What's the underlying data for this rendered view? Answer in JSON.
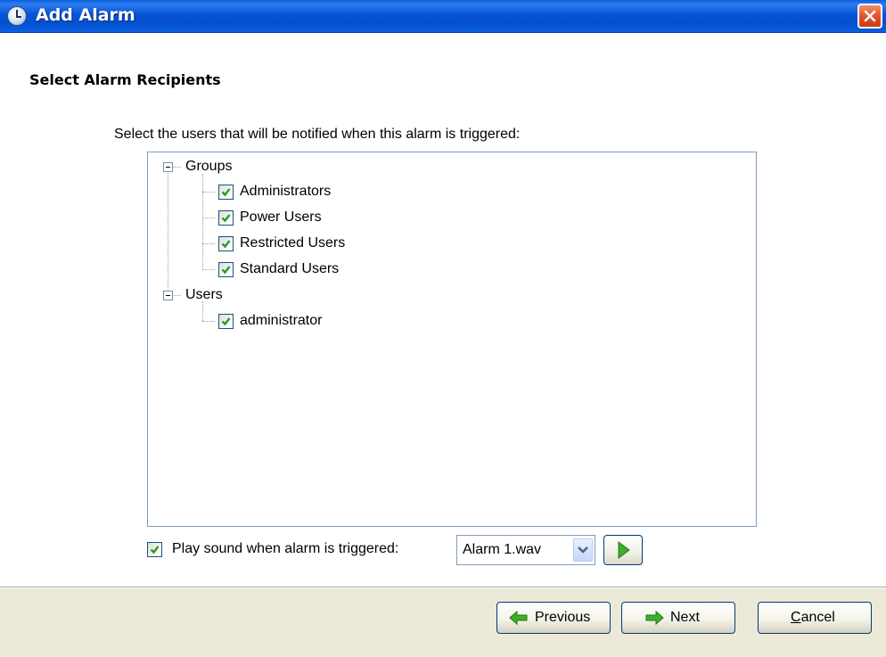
{
  "window": {
    "title": "Add Alarm"
  },
  "page": {
    "heading": "Select Alarm Recipients",
    "instruction": "Select the users that will be notified when this alarm is triggered:"
  },
  "tree": {
    "groups": {
      "label": "Groups",
      "expanded": true,
      "items": [
        {
          "label": "Administrators",
          "checked": true
        },
        {
          "label": "Power Users",
          "checked": true
        },
        {
          "label": "Restricted Users",
          "checked": true
        },
        {
          "label": "Standard Users",
          "checked": true
        }
      ]
    },
    "users": {
      "label": "Users",
      "expanded": true,
      "items": [
        {
          "label": "administrator",
          "checked": true
        }
      ]
    }
  },
  "sound": {
    "checked": true,
    "label": "Play sound when alarm is triggered:",
    "selected_value": "Alarm 1.wav"
  },
  "buttons": {
    "previous": "Previous",
    "next": "Next",
    "cancel": "Cancel"
  },
  "colors": {
    "titlebar": "#0a5fd8",
    "check": "#21a121",
    "arrow_green": "#3fae29",
    "footer": "#ece9d8"
  },
  "icons": {
    "title": "clock-icon",
    "close": "close-icon",
    "previous": "arrow-left-icon",
    "next": "arrow-right-icon",
    "play": "play-icon",
    "dropdown": "chevron-down-icon"
  }
}
